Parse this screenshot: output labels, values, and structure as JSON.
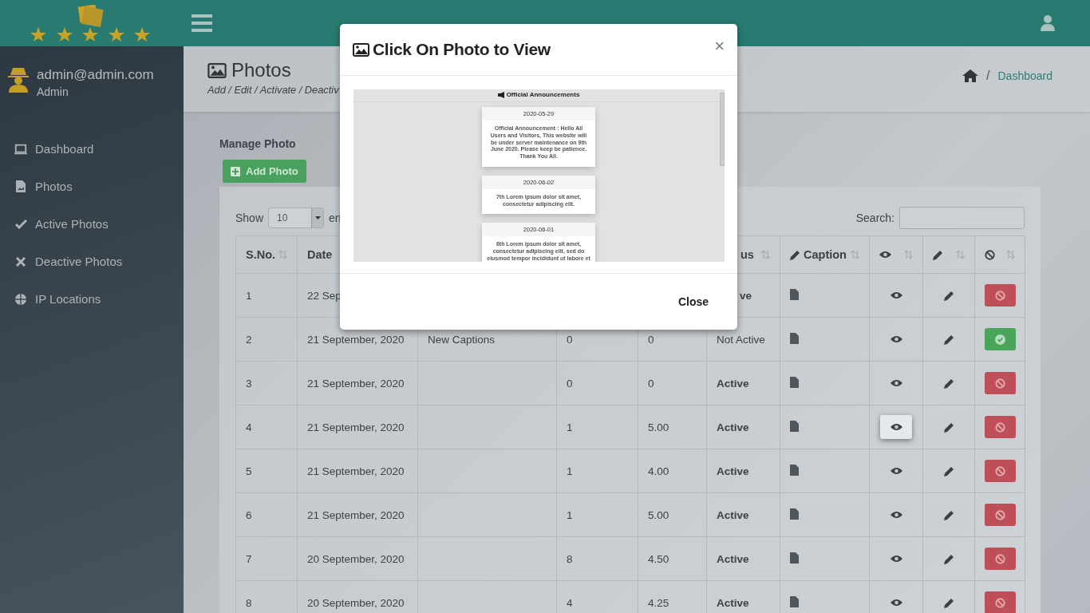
{
  "sidebar": {
    "user": {
      "email": "admin@admin.com",
      "role": "Admin"
    },
    "items": [
      {
        "label": "Dashboard"
      },
      {
        "label": "Photos"
      },
      {
        "label": "Active Photos"
      },
      {
        "label": "Deactive Photos"
      },
      {
        "label": "IP Locations"
      }
    ]
  },
  "page_header": {
    "title": "Photos",
    "subtitle": "Add / Edit / Activate / Deactiv",
    "breadcrumb_separator": "/",
    "breadcrumb": "Dashboard"
  },
  "panel": {
    "title": "Manage Photo",
    "add_button": "Add Photo",
    "show_label": "Show",
    "page_size": "10",
    "entries_label": "en",
    "search_label": "Search:"
  },
  "table": {
    "columns": {
      "sno": "S.No.",
      "date": "Date",
      "status": "us",
      "caption": "Caption"
    },
    "rows": [
      {
        "sno": "1",
        "date": "22 Sep",
        "status": "ve",
        "active": true,
        "view_focused": false
      },
      {
        "sno": "2",
        "date": "21 September, 2020",
        "column_3": "New Captions",
        "column_4": "0",
        "column_5": "0",
        "status": "Not Active",
        "active": false,
        "view_focused": false
      },
      {
        "sno": "3",
        "date": "21 September, 2020",
        "column_4": "0",
        "column_5": "0",
        "status": "Active",
        "active": true,
        "view_focused": false
      },
      {
        "sno": "4",
        "date": "21 September, 2020",
        "column_4": "1",
        "column_5": "5.00",
        "status": "Active",
        "active": true,
        "view_focused": true
      },
      {
        "sno": "5",
        "date": "21 September, 2020",
        "column_4": "1",
        "column_5": "4.00",
        "status": "Active",
        "active": true,
        "view_focused": false
      },
      {
        "sno": "6",
        "date": "21 September, 2020",
        "column_4": "1",
        "column_5": "5.00",
        "status": "Active",
        "active": true,
        "view_focused": false
      },
      {
        "sno": "7",
        "date": "20 September, 2020",
        "column_4": "8",
        "column_5": "4.50",
        "status": "Active",
        "active": true,
        "view_focused": false
      },
      {
        "sno": "8",
        "date": "20 September, 2020",
        "column_4": "4",
        "column_5": "4.25",
        "status": "Active",
        "active": true,
        "view_focused": false
      }
    ]
  },
  "modal": {
    "title": "Click On Photo to View",
    "close_icon": "×",
    "close_button": "Close",
    "preview": {
      "heading": "Official Announcements",
      "cards": [
        {
          "date": "2020-05-29",
          "text": "Official Announcement : Hello All Users and Visitors, This website will be under server maintenance on 9th June 2020. Please keep be patience. Thank You All."
        },
        {
          "date": "2020-06-02",
          "text": "7th Lorem ipsum dolor sit amet, consectetur adipiscing elit."
        },
        {
          "date": "2020-06-01",
          "text": "6th Lorem ipsum dolor sit amet, consectetur adipiscing elit, sed do eiusmod tempor incididunt ut labore et"
        }
      ]
    }
  }
}
